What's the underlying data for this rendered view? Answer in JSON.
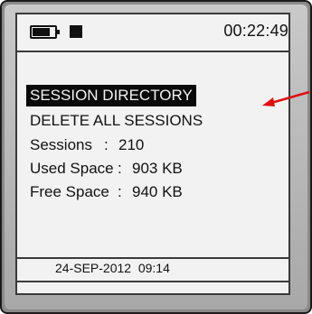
{
  "status_bar": {
    "battery_icon": "battery-icon",
    "storage_icon": "storage-icon",
    "time": "00:22:49"
  },
  "menu": {
    "items": [
      {
        "label": "SESSION DIRECTORY",
        "selected": true
      },
      {
        "label": "DELETE ALL SESSIONS",
        "selected": false
      }
    ]
  },
  "info": {
    "sessions": {
      "label": "Sessions",
      "sep": ":",
      "value": "210"
    },
    "used_space": {
      "label": "Used Space",
      "sep": ":",
      "value": "903 KB"
    },
    "free_space": {
      "label": "Free Space",
      "sep": ":",
      "value": "940 KB"
    }
  },
  "footer": {
    "datetime": "24-SEP-2012  09:14"
  },
  "colors": {
    "annotation_arrow": "#e01010",
    "selection_bg": "#0a0a0a",
    "screen_bg": "#f2f2f2"
  }
}
